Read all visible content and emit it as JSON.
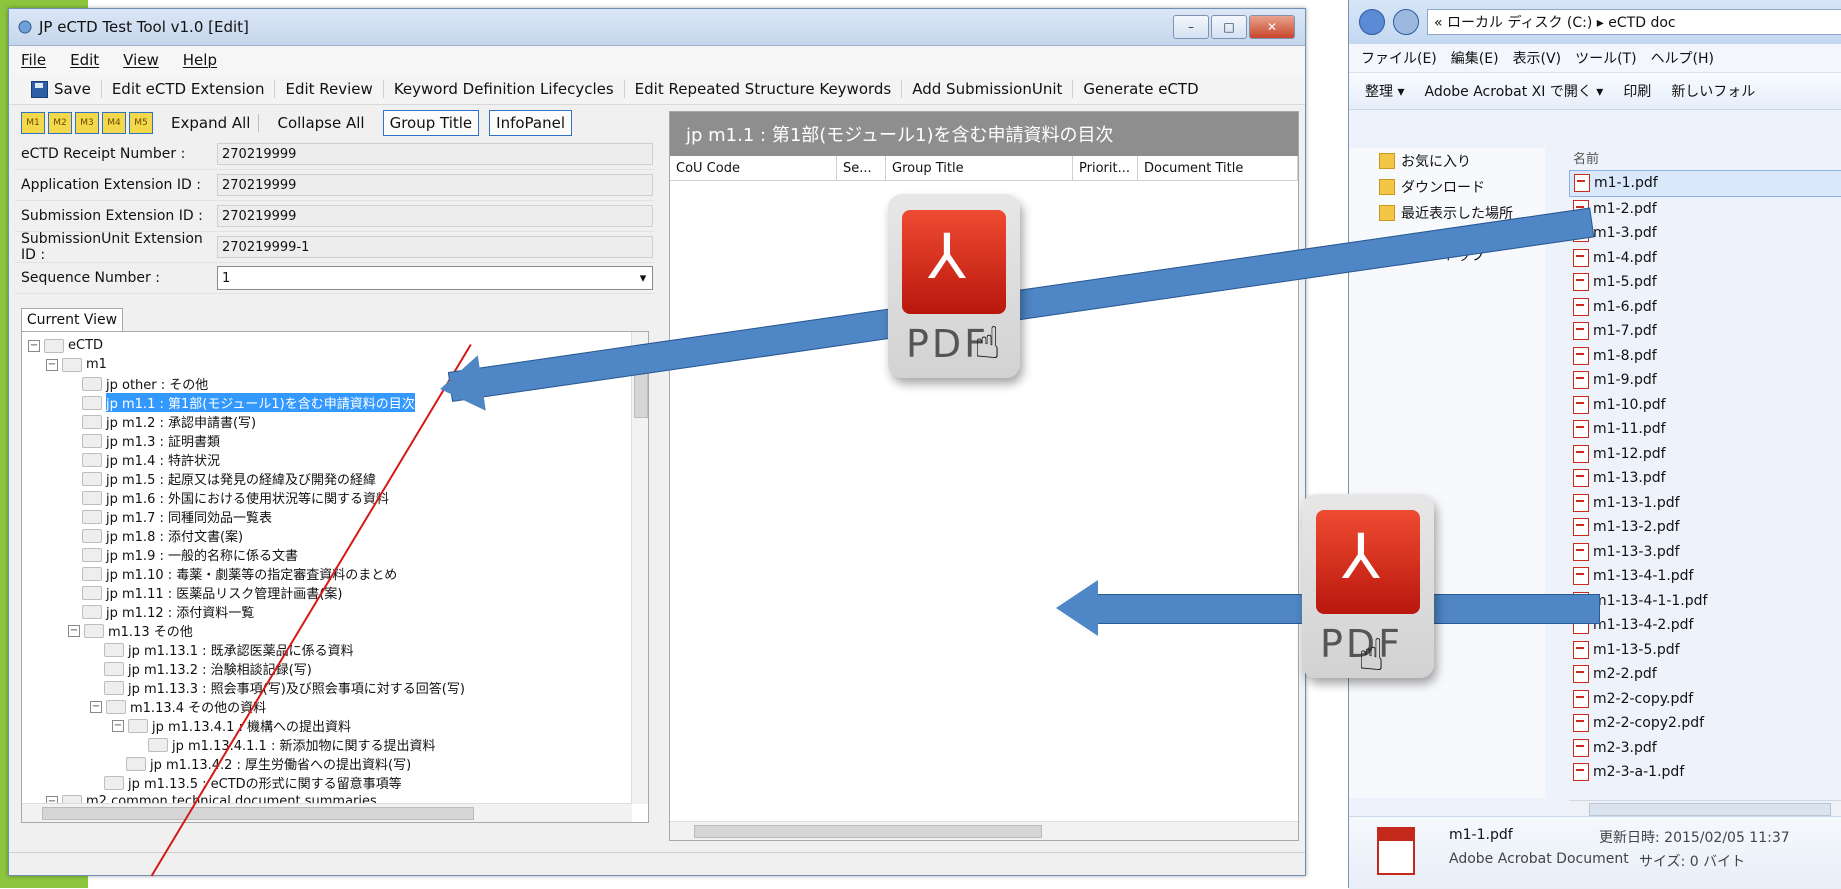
{
  "window": {
    "title": "JP eCTD Test Tool v1.0 [Edit]",
    "buttons": {
      "minimize": "–",
      "maximize": "□",
      "close": "✕"
    }
  },
  "menubar": {
    "items": [
      "File",
      "Edit",
      "View",
      "Help"
    ]
  },
  "toolbar": {
    "save_label": "Save",
    "items": [
      "Edit eCTD Extension",
      "Edit Review",
      "Keyword Definition Lifecycles",
      "Edit Repeated Structure Keywords",
      "Add SubmissionUnit",
      "Generate eCTD"
    ]
  },
  "left": {
    "modules": [
      "M1",
      "M2",
      "M3",
      "M4",
      "M5"
    ],
    "expand_all": "Expand All",
    "collapse_all": "Collapse All",
    "group_title": "Group Title",
    "info_panel": "InfoPanel",
    "fields": [
      {
        "label": "eCTD Receipt Number :",
        "value": "270219999"
      },
      {
        "label": "Application Extension ID :",
        "value": "270219999"
      },
      {
        "label": "Submission Extension ID :",
        "value": "270219999"
      },
      {
        "label": "SubmissionUnit Extension ID :",
        "value": "270219999-1"
      }
    ],
    "sequence_label": "Sequence Number :",
    "sequence_value": "1",
    "tab_current_view": "Current View",
    "tree": [
      {
        "label": "eCTD",
        "toggle": "⊟"
      },
      {
        "label": "m1",
        "toggle": "⊟"
      },
      {
        "label": "jp other : その他"
      },
      {
        "label": "jp m1.1 : 第1部(モジュール1)を含む申請資料の目次",
        "selected": true
      },
      {
        "label": "jp m1.2 : 承認申請書(写)"
      },
      {
        "label": "jp m1.3 : 証明書類"
      },
      {
        "label": "jp m1.4 : 特許状況"
      },
      {
        "label": "jp m1.5 : 起原又は発見の経緯及び開発の経緯"
      },
      {
        "label": "jp m1.6 : 外国における使用状況等に関する資料"
      },
      {
        "label": "jp m1.7 : 同種同効品一覧表"
      },
      {
        "label": "jp m1.8 : 添付文書(案)"
      },
      {
        "label": "jp m1.9 : 一般的名称に係る文書"
      },
      {
        "label": "jp m1.10 : 毒薬・劇薬等の指定審査資料のまとめ"
      },
      {
        "label": "jp m1.11 : 医薬品リスク管理計画書(案)"
      },
      {
        "label": "jp m1.12 : 添付資料一覧"
      },
      {
        "label": "m1.13 その他",
        "toggle": "⊟"
      },
      {
        "label": "jp m1.13.1 : 既承認医薬品に係る資料"
      },
      {
        "label": "jp m1.13.2 : 治験相談記録(写)"
      },
      {
        "label": "jp m1.13.3 : 照会事項(写)及び照会事項に対する回答(写)"
      },
      {
        "label": "m1.13.4 その他の資料",
        "toggle": "⊟"
      },
      {
        "label": "jp m1.13.4.1 : 機構への提出資料",
        "toggle": "⊟"
      },
      {
        "label": "jp m1.13.4.1.1 : 新添加物に関する提出資料"
      },
      {
        "label": "jp m1.13.4.2 : 厚生労働省への提出資料(写)"
      },
      {
        "label": "jp m1.13.5 : eCTDの形式に関する留意事項等"
      },
      {
        "label": "m2 common technical document summaries",
        "toggle": "⊟"
      }
    ]
  },
  "right": {
    "header": "jp m1.1 : 第1部(モジュール1)を含む申請資料の目次",
    "columns": [
      "CoU Code",
      "Se...",
      "Group Title",
      "Priorit...",
      "Document Title"
    ]
  },
  "explorer": {
    "address": "« ローカル ディスク (C:) ▸ eCTD doc",
    "menu": [
      "ファイル(E)",
      "編集(E)",
      "表示(V)",
      "ツール(T)",
      "ヘルプ(H)"
    ],
    "tools": [
      "整理 ▾",
      "Adobe Acrobat XI で開く ▾",
      "印刷",
      "新しいフォル"
    ],
    "nav": [
      "お気に入り",
      "ダウンロード",
      "最近表示した場所",
      "デスクトップ"
    ],
    "col_name": "名前",
    "files": [
      "m1-1.pdf",
      "m1-2.pdf",
      "m1-3.pdf",
      "m1-4.pdf",
      "m1-5.pdf",
      "m1-6.pdf",
      "m1-7.pdf",
      "m1-8.pdf",
      "m1-9.pdf",
      "m1-10.pdf",
      "m1-11.pdf",
      "m1-12.pdf",
      "m1-13.pdf",
      "m1-13-1.pdf",
      "m1-13-2.pdf",
      "m1-13-3.pdf",
      "m1-13-4-1.pdf",
      "m1-13-4-1-1.pdf",
      "m1-13-4-2.pdf",
      "m1-13-5.pdf",
      "m2-2.pdf",
      "m2-2-copy.pdf",
      "m2-2-copy2.pdf",
      "m2-3.pdf",
      "m2-3-a-1.pdf"
    ],
    "details": {
      "name": "m1-1.pdf",
      "type": "Adobe Acrobat Document",
      "date": "更新日時: 2015/02/05 11:37",
      "size": "サイズ: 0 バイト"
    }
  },
  "overlay": {
    "pdf_text": "PDF"
  },
  "colors": {
    "selection": "#3399ff",
    "arrow": "#4f86c6",
    "header": "#8e8e8e",
    "module_button": "#f2d84a"
  },
  "icons": [
    "app-icon",
    "save-icon",
    "folder-icon",
    "pdf-file-icon",
    "pdf-logo-icon",
    "hand-cursor-icon"
  ]
}
